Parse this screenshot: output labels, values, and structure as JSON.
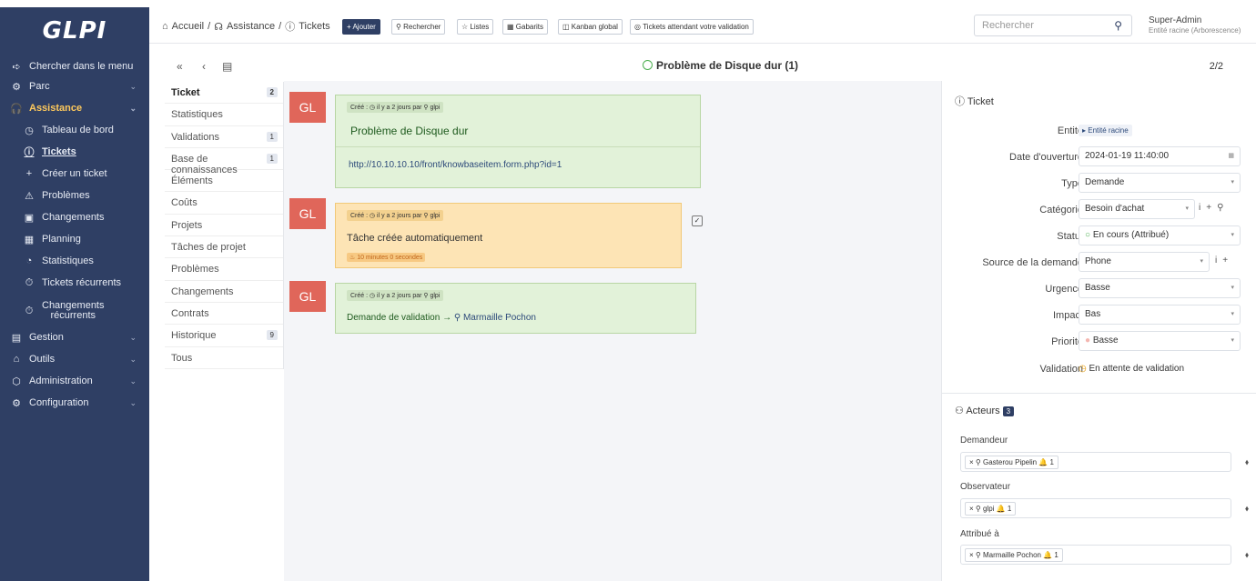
{
  "brand": "GLPI",
  "menu": [
    {
      "label": "Chercher dans le menu",
      "icon": "➪"
    },
    {
      "label": "Parc",
      "icon": "⚙"
    },
    {
      "label": "Assistance",
      "icon": "🎧"
    },
    {
      "label": "Tableau de bord",
      "icon": "◷"
    },
    {
      "label": "Tickets",
      "icon": "ⓘ"
    },
    {
      "label": "Créer un ticket",
      "icon": "+"
    },
    {
      "label": "Problèmes",
      "icon": "⚠"
    },
    {
      "label": "Changements",
      "icon": "▣"
    },
    {
      "label": "Planning",
      "icon": "▦"
    },
    {
      "label": "Statistiques",
      "icon": "◔"
    },
    {
      "label": "Tickets récurrents",
      "icon": "⏱"
    },
    {
      "label": "Changements",
      "label2": "récurrents",
      "icon": "⏱"
    },
    {
      "label": "Gestion",
      "icon": "▤"
    },
    {
      "label": "Outils",
      "icon": "⌂"
    },
    {
      "label": "Administration",
      "icon": "⬡"
    },
    {
      "label": "Configuration",
      "icon": "⚙"
    }
  ],
  "breadcrumb": {
    "home": "Accueil",
    "section": "Assistance",
    "page": "Tickets"
  },
  "toolbar": {
    "add": "+ Ajouter",
    "search": "Rechercher",
    "lists": "Listes",
    "templates": "Gabarits",
    "kanban": "Kanban global",
    "waiting": "Tickets attendant votre validation"
  },
  "search": {
    "placeholder": "Rechercher"
  },
  "user": {
    "name": "Super-Admin",
    "entity": "Entité racine (Arborescence)"
  },
  "ticket": {
    "title": "Problème de Disque dur (1)",
    "pager": "2/2"
  },
  "tabs": [
    {
      "label": "Ticket",
      "count": "2"
    },
    {
      "label": "Statistiques"
    },
    {
      "label": "Validations",
      "count": "1"
    },
    {
      "label": "Base de connaissances",
      "count": "1"
    },
    {
      "label": "Éléments"
    },
    {
      "label": "Coûts"
    },
    {
      "label": "Projets"
    },
    {
      "label": "Tâches de projet"
    },
    {
      "label": "Problèmes"
    },
    {
      "label": "Changements"
    },
    {
      "label": "Contrats"
    },
    {
      "label": "Historique",
      "count": "9"
    },
    {
      "label": "Tous"
    }
  ],
  "timeline": {
    "avatar": "GL",
    "item1": {
      "meta": "Créé : ◷ il y a 2 jours par ⚲ glpi",
      "title": "Problème de Disque dur",
      "link": "http://10.10.10.10/front/knowbaseitem.form.php?id=1"
    },
    "item2": {
      "meta": "Créé : ◷ il y a 2 jours par ⚲ glpi",
      "text": "Tâche créée automatiquement",
      "duration": "10 minutes 0 secondes"
    },
    "item3": {
      "meta": "Créé : ◷ il y a 2 jours par ⚲ glpi",
      "text": "Demande de validation →",
      "user": "⚲ Marmaille Pochon"
    }
  },
  "panel": {
    "ticket_header": "Ticket",
    "entity_label": "Entité",
    "entity_value": "▸ Entité racine",
    "date_label": "Date d'ouverture",
    "date_value": "2024-01-19 11:40:00",
    "type_label": "Type",
    "type_value": "Demande",
    "cat_label": "Catégorie",
    "cat_value": "Besoin d'achat",
    "status_label": "Statut",
    "status_value": "En cours (Attribué)",
    "source_label": "Source de la demande",
    "source_value": "Phone",
    "urgency_label": "Urgence",
    "urgency_value": "Basse",
    "impact_label": "Impact",
    "impact_value": "Bas",
    "priority_label": "Priorité",
    "priority_value": "Basse",
    "validation_label": "Validation",
    "validation_value": "En attente de validation",
    "actors_header": "Acteurs",
    "actors_count": "3",
    "requester_label": "Demandeur",
    "requester": "× ⚲ Gasterou Pipelin 🔔 1",
    "observer_label": "Observateur",
    "observer": "× ⚲ glpi 🔔 1",
    "assigned_label": "Attribué à",
    "assigned": "× ⚲ Marmaille Pochon 🔔 1"
  },
  "colors": {
    "sidebar": "#2f3f64",
    "accent": "#fec95c",
    "avatar": "#e0665a",
    "green_bubble": "#e2f2d9",
    "orange_bubble": "#fde4b5"
  }
}
